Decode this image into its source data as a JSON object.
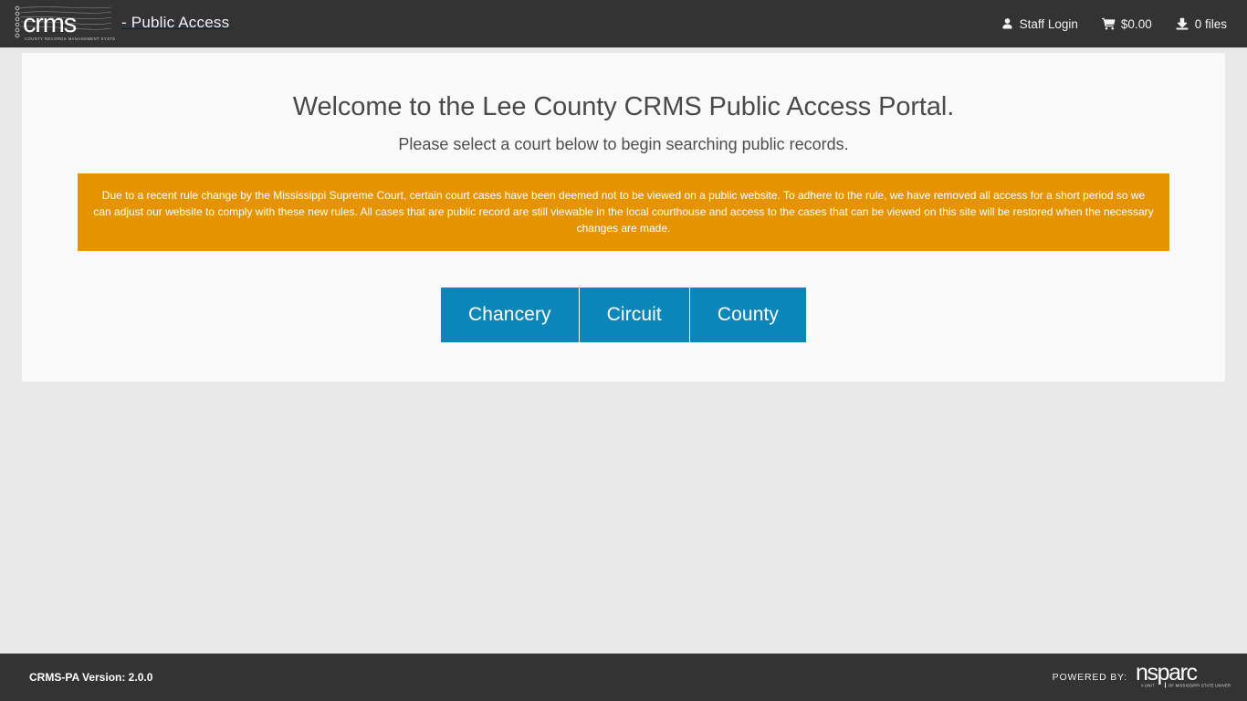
{
  "header": {
    "logo": {
      "wordmark": "crms",
      "tagline": "COUNTY RECORDS MANAGEMENT SYSTEM",
      "suffix": "- Public Access"
    },
    "nav": [
      {
        "icon": "user-icon",
        "label": "Staff Login"
      },
      {
        "icon": "shopping-cart-icon",
        "label": "$0.00"
      },
      {
        "icon": "download-icon",
        "label": "0 files"
      }
    ]
  },
  "main": {
    "title": "Welcome to the Lee County CRMS Public Access Portal.",
    "subtitle": "Please select a court below to begin searching public records.",
    "alert": {
      "text": "Due to a recent rule change by the Mississippi Supreme Court, certain court cases have been deemed not to be viewed on a public website. To adhere to the rule, we have removed all access for a short period so we can adjust our website to comply with these new rules. All cases that are public record are still viewable in the local courthouse and access to the cases that can be viewed on this site will be restored when the necessary changes are made."
    },
    "court_buttons": [
      {
        "label": "Chancery"
      },
      {
        "label": "Circuit"
      },
      {
        "label": "County"
      }
    ]
  },
  "footer": {
    "version": "CRMS-PA Version: 2.0.0",
    "powered_by_label": "POWERED BY:",
    "powered_by_logo": {
      "wordmark": "nsparc",
      "tagline": "A UNIT OF MISSISSIPPI STATE UNIVERSITY™"
    }
  },
  "colors": {
    "header_bg": "#333333",
    "page_bg": "#e9e9e9",
    "card_bg": "#fafafa",
    "alert_bg": "#e59400",
    "button_bg": "#0b86b8",
    "title_text": "#4a4a4a"
  }
}
